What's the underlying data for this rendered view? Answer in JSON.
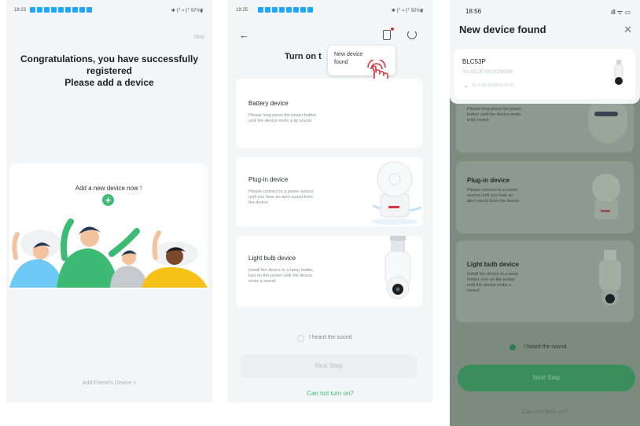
{
  "screen1": {
    "status_time": "18:23",
    "status_right": "✱ ⁅ᵀ ≈ ⁅ᵀ 97%▮",
    "skip": "Skip",
    "headline_line1": "Congratulations, you have successfully",
    "headline_line2": "registered",
    "headline_line3": "Please add a device",
    "add_card_label": "Add a new device now !",
    "add_friends_device": "Add Friend's Device  >"
  },
  "screen2": {
    "status_time": "19:25",
    "status_right": "✱ ⁅ᵀ ≈ ⁅ᵀ 92%▮",
    "title": "Turn on t",
    "tooltip_line1": "New device",
    "tooltip_line2": "found",
    "devices": [
      {
        "title": "Battery device",
        "desc_line1": "Please long press the power button",
        "desc_line2": "until the device emits a tip sound."
      },
      {
        "title": "Plug-in device",
        "desc_line1": "Please connect to a power source",
        "desc_line2": "until you hear an alert sound from",
        "desc_line3": "the device"
      },
      {
        "title": "Light bulb device",
        "desc_line1": "Install the device to a lamp holder,",
        "desc_line2": "turn on the power until the device",
        "desc_line3": "emits a sound."
      }
    ],
    "heard_sound": "I heard the sound",
    "next_step": "Next Step",
    "cannot_turn_on": "Can not turn on?"
  },
  "screen3": {
    "status_time": "18:56",
    "status_right": "ıll ᯤ ▭",
    "title": "New device found",
    "found_device": {
      "name": "BLC53P",
      "serial": "SN:AICJEYBGYZ90098",
      "wifi_info": "Wi-Fi 66:48:28:06:06:10"
    },
    "devices": [
      {
        "title": "",
        "desc_line1": "Please long press the power",
        "desc_line2": "button until the device emits",
        "desc_line3": "a tip sound."
      },
      {
        "title": "Plug-in device",
        "desc_line1": "Please connect to a power",
        "desc_line2": "source until you hear an",
        "desc_line3": "alert sound from the device"
      },
      {
        "title": "Light bulb device",
        "desc_line1": "Install the device to a lamp",
        "desc_line2": "holder, turn on the power",
        "desc_line3": "until the device emits a",
        "desc_line4": "sound."
      }
    ],
    "heard_sound": "I heard the sound",
    "next_step": "Next Step",
    "cannot_turn_on": "Can not turn on?"
  },
  "colors": {
    "accent_green": "#3dbb74",
    "status_blue": "#1ea7ff",
    "tap_red": "#e0323b",
    "overlay": "#7d8a80"
  }
}
